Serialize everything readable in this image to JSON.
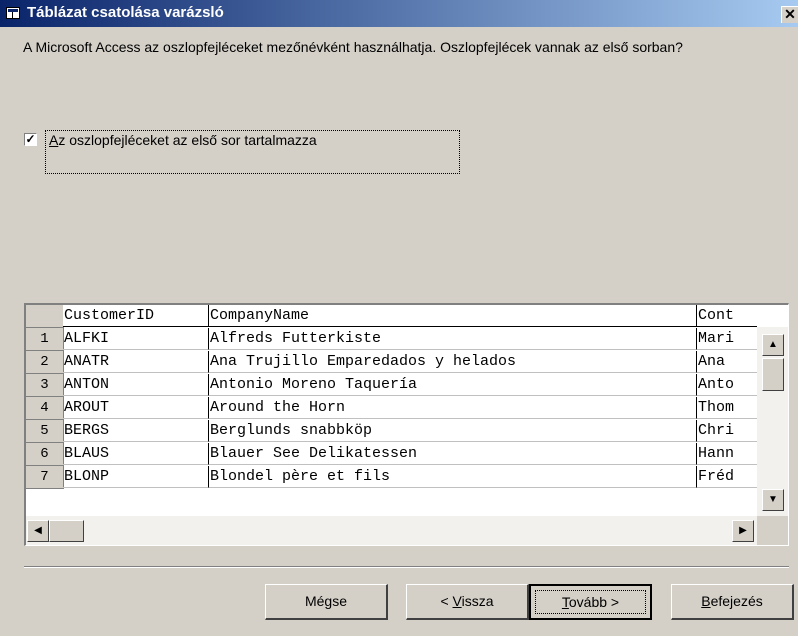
{
  "window": {
    "title": "Táblázat csatolása varázsló",
    "close_glyph": "✕"
  },
  "prompt": "A Microsoft Access az oszlopfejléceket mezőnévként használhatja. Oszlopfejlécek vannak az első sorban?",
  "checkbox": {
    "checked": true,
    "mark": "✓",
    "label_first": "A",
    "label_rest": "z oszlopfejléceket az első sor tartalmazza"
  },
  "grid": {
    "columns": [
      "CustomerID",
      "CompanyName",
      "Cont"
    ],
    "rows": [
      {
        "n": "1",
        "id": "ALFKI",
        "company": "Alfreds Futterkiste",
        "contact": "Mari"
      },
      {
        "n": "2",
        "id": "ANATR",
        "company": "Ana Trujillo Emparedados y helados",
        "contact": "Ana"
      },
      {
        "n": "3",
        "id": "ANTON",
        "company": "Antonio Moreno Taquería",
        "contact": "Anto"
      },
      {
        "n": "4",
        "id": "AROUT",
        "company": "Around the Horn",
        "contact": "Thom"
      },
      {
        "n": "5",
        "id": "BERGS",
        "company": "Berglunds snabbköp",
        "contact": "Chri"
      },
      {
        "n": "6",
        "id": "BLAUS",
        "company": "Blauer See Delikatessen",
        "contact": "Hann"
      },
      {
        "n": "7",
        "id": "BLONP",
        "company": "Blondel père et fils",
        "contact": "Fréd"
      }
    ],
    "scroll_up": "▲",
    "scroll_down": "▼",
    "scroll_left": "◀",
    "scroll_right": "▶"
  },
  "buttons": {
    "cancel": "Mégse",
    "back_prefix": "< ",
    "back_key": "V",
    "back_rest": "issza",
    "next_key": "T",
    "next_rest": "ovább >",
    "finish_key": "B",
    "finish_rest": "efejezés"
  }
}
